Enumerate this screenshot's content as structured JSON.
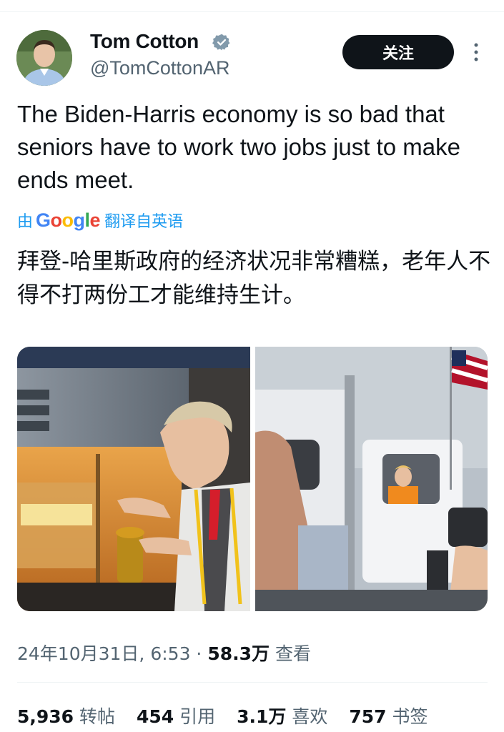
{
  "tweet": {
    "author_name": "Tom Cotton",
    "author_handle": "@TomCottonAR",
    "follow_label": "关注",
    "text": "The Biden-Harris economy is so bad that seniors have to work two jobs just to make ends meet.",
    "translation_prefix": "由",
    "translation_brand": "Google",
    "translation_suffix": "翻译自英语",
    "translated_text": "拜登-哈里斯政府的经济状况非常糟糕，老年人不得不打两份工才能维持生计。",
    "timestamp": "24年10月31日, 6:53",
    "separator": "·",
    "views_count": "58.3万",
    "views_label": "查看"
  },
  "stats": [
    {
      "count": "5,936",
      "label": "转帖"
    },
    {
      "count": "454",
      "label": "引用"
    },
    {
      "count": "3.1万",
      "label": "喜欢"
    },
    {
      "count": "757",
      "label": "书签"
    }
  ],
  "colors": {
    "accent": "#1d9bf0",
    "text_primary": "#0f1419",
    "text_secondary": "#536471",
    "follow_bg": "#0f1419"
  },
  "icons": {
    "verified": "verified-badge-icon",
    "more": "more-vertical-icon"
  }
}
